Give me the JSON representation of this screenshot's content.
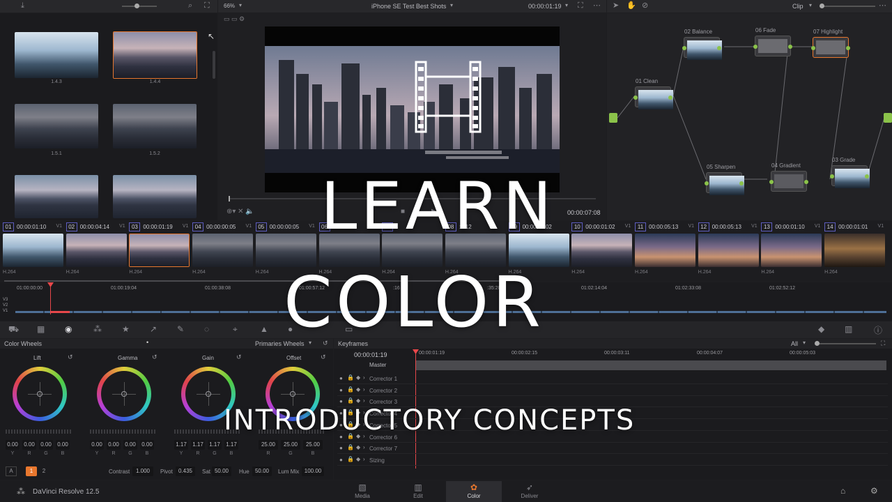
{
  "viewer": {
    "zoom": "66%",
    "title": "iPhone SE Test Best Shots",
    "timecode": "00:00:01:19",
    "duration": "00:00:07:08"
  },
  "gallery": {
    "items": [
      {
        "label": "1.4.3"
      },
      {
        "label": "1.4.4"
      },
      {
        "label": "1.5.1"
      },
      {
        "label": "1.5.2"
      }
    ]
  },
  "nodes": {
    "mode": "Clip",
    "items": [
      {
        "label": "01 Clean"
      },
      {
        "label": "02 Balance"
      },
      {
        "label": "06 Fade"
      },
      {
        "label": "07 Highlight"
      },
      {
        "label": "05 Sharpen"
      },
      {
        "label": "04 Gradient"
      },
      {
        "label": "03 Grade"
      }
    ]
  },
  "clips": [
    {
      "num": "01",
      "tc": "00:00:01:10",
      "track": "V1",
      "codec": "H.264"
    },
    {
      "num": "02",
      "tc": "00:00:04:14",
      "track": "V1",
      "codec": "H.264"
    },
    {
      "num": "03",
      "tc": "00:00:01:19",
      "track": "V1",
      "codec": "H.264"
    },
    {
      "num": "04",
      "tc": "00:00:00:05",
      "track": "V1",
      "codec": "H.264"
    },
    {
      "num": "05",
      "tc": "00:00:00:05",
      "track": "V1",
      "codec": "H.264"
    },
    {
      "num": "06",
      "tc": ":20",
      "track": "",
      "codec": "H.264"
    },
    {
      "num": "07",
      "tc": "",
      "track": "",
      "codec": "H.264"
    },
    {
      "num": "08",
      "tc": ":7:12",
      "track": "",
      "codec": "H.264"
    },
    {
      "num": "09",
      "tc": "00:00:01:02",
      "track": "",
      "codec": "H.264"
    },
    {
      "num": "10",
      "tc": "00:00:01:02",
      "track": "V1",
      "codec": "H.264"
    },
    {
      "num": "11",
      "tc": "00:00:05:13",
      "track": "V1",
      "codec": "H.264"
    },
    {
      "num": "12",
      "tc": "00:00:05:13",
      "track": "V1",
      "codec": "H.264"
    },
    {
      "num": "13",
      "tc": "00:00:01:10",
      "track": "V1",
      "codec": "H.264"
    },
    {
      "num": "14",
      "tc": "00:00:01:01",
      "track": "V1",
      "codec": "H.264"
    }
  ],
  "timeline": {
    "ruler": [
      "01:00:00:00",
      "01:00:19:04",
      "01:00:38:08",
      "01:00:57:12",
      ":16",
      ":35:20",
      "01:02:14:04",
      "01:02:33:08",
      "01:02:52:12"
    ],
    "tracks": [
      "V3",
      "V2",
      "V1"
    ]
  },
  "color_wheels": {
    "title": "Color Wheels",
    "mode": "Primaries Wheels",
    "wheels": [
      {
        "name": "Lift",
        "values": [
          "0.00",
          "0.00",
          "0.00",
          "0.00"
        ]
      },
      {
        "name": "Gamma",
        "values": [
          "0.00",
          "0.00",
          "0.00",
          "0.00"
        ]
      },
      {
        "name": "Gain",
        "values": [
          "1.17",
          "1.17",
          "1.17",
          "1.17"
        ]
      },
      {
        "name": "Offset",
        "values": [
          "25.00",
          "25.00",
          "25.00"
        ]
      }
    ],
    "channel_labels": [
      "Y",
      "R",
      "G",
      "B"
    ],
    "page_a": "A",
    "page_1": "1",
    "page_2": "2",
    "contrast_label": "Contrast",
    "contrast": "1.000",
    "pivot_label": "Pivot",
    "pivot": "0.435",
    "sat_label": "Sat",
    "sat": "50.00",
    "hue_label": "Hue",
    "hue": "50.00",
    "lummix_label": "Lum Mix",
    "lummix": "100.00"
  },
  "keyframes": {
    "title": "Keyframes",
    "filter": "All",
    "timecode": "00:00:01:19",
    "ruler": [
      "00:00:01:19",
      "00:00:02:15",
      "00:00:03:11",
      "00:00:04:07",
      "00:00:05:03"
    ],
    "master": "Master",
    "rows": [
      "Corrector 1",
      "Corrector 2",
      "Corrector 3",
      "Corrector 4",
      "Corrector 5",
      "Corrector 6",
      "Corrector 7",
      "Sizing"
    ]
  },
  "bottom": {
    "app_name": "DaVinci Resolve 12.5",
    "tabs": [
      {
        "label": "Media"
      },
      {
        "label": "Edit"
      },
      {
        "label": "Color"
      },
      {
        "label": "Deliver"
      }
    ]
  },
  "overlay": {
    "line1": "LEARN",
    "line2": "COLOR",
    "line3": "INTRODUCTORY CONCEPTS"
  },
  "colors": {
    "accent": "#e8772e",
    "active_tab": "#2d2d31",
    "overlay": "#ffffff"
  }
}
